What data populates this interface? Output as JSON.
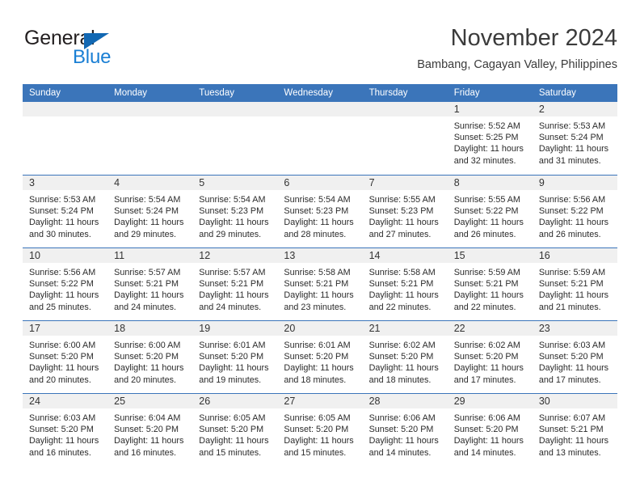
{
  "brand": {
    "name_top": "General",
    "name_bottom": "Blue",
    "triangle_color": "#1268b3",
    "blue_text_color": "#1a7fd4"
  },
  "header": {
    "month_title": "November 2024",
    "location": "Bambang, Cagayan Valley, Philippines"
  },
  "theme": {
    "header_blue": "#3b75ba",
    "daynum_band": "#f0f0f0",
    "cell_bg": "#ffffff",
    "text": "#2b2b2b"
  },
  "calendar": {
    "weekday_headers": [
      "Sunday",
      "Monday",
      "Tuesday",
      "Wednesday",
      "Thursday",
      "Friday",
      "Saturday"
    ],
    "weeks": [
      [
        {
          "day": "",
          "empty": true
        },
        {
          "day": "",
          "empty": true
        },
        {
          "day": "",
          "empty": true
        },
        {
          "day": "",
          "empty": true
        },
        {
          "day": "",
          "empty": true
        },
        {
          "day": "1",
          "sunrise": "Sunrise: 5:52 AM",
          "sunset": "Sunset: 5:25 PM",
          "daylight": "Daylight: 11 hours and 32 minutes."
        },
        {
          "day": "2",
          "sunrise": "Sunrise: 5:53 AM",
          "sunset": "Sunset: 5:24 PM",
          "daylight": "Daylight: 11 hours and 31 minutes."
        }
      ],
      [
        {
          "day": "3",
          "sunrise": "Sunrise: 5:53 AM",
          "sunset": "Sunset: 5:24 PM",
          "daylight": "Daylight: 11 hours and 30 minutes."
        },
        {
          "day": "4",
          "sunrise": "Sunrise: 5:54 AM",
          "sunset": "Sunset: 5:24 PM",
          "daylight": "Daylight: 11 hours and 29 minutes."
        },
        {
          "day": "5",
          "sunrise": "Sunrise: 5:54 AM",
          "sunset": "Sunset: 5:23 PM",
          "daylight": "Daylight: 11 hours and 29 minutes."
        },
        {
          "day": "6",
          "sunrise": "Sunrise: 5:54 AM",
          "sunset": "Sunset: 5:23 PM",
          "daylight": "Daylight: 11 hours and 28 minutes."
        },
        {
          "day": "7",
          "sunrise": "Sunrise: 5:55 AM",
          "sunset": "Sunset: 5:23 PM",
          "daylight": "Daylight: 11 hours and 27 minutes."
        },
        {
          "day": "8",
          "sunrise": "Sunrise: 5:55 AM",
          "sunset": "Sunset: 5:22 PM",
          "daylight": "Daylight: 11 hours and 26 minutes."
        },
        {
          "day": "9",
          "sunrise": "Sunrise: 5:56 AM",
          "sunset": "Sunset: 5:22 PM",
          "daylight": "Daylight: 11 hours and 26 minutes."
        }
      ],
      [
        {
          "day": "10",
          "sunrise": "Sunrise: 5:56 AM",
          "sunset": "Sunset: 5:22 PM",
          "daylight": "Daylight: 11 hours and 25 minutes."
        },
        {
          "day": "11",
          "sunrise": "Sunrise: 5:57 AM",
          "sunset": "Sunset: 5:21 PM",
          "daylight": "Daylight: 11 hours and 24 minutes."
        },
        {
          "day": "12",
          "sunrise": "Sunrise: 5:57 AM",
          "sunset": "Sunset: 5:21 PM",
          "daylight": "Daylight: 11 hours and 24 minutes."
        },
        {
          "day": "13",
          "sunrise": "Sunrise: 5:58 AM",
          "sunset": "Sunset: 5:21 PM",
          "daylight": "Daylight: 11 hours and 23 minutes."
        },
        {
          "day": "14",
          "sunrise": "Sunrise: 5:58 AM",
          "sunset": "Sunset: 5:21 PM",
          "daylight": "Daylight: 11 hours and 22 minutes."
        },
        {
          "day": "15",
          "sunrise": "Sunrise: 5:59 AM",
          "sunset": "Sunset: 5:21 PM",
          "daylight": "Daylight: 11 hours and 22 minutes."
        },
        {
          "day": "16",
          "sunrise": "Sunrise: 5:59 AM",
          "sunset": "Sunset: 5:21 PM",
          "daylight": "Daylight: 11 hours and 21 minutes."
        }
      ],
      [
        {
          "day": "17",
          "sunrise": "Sunrise: 6:00 AM",
          "sunset": "Sunset: 5:20 PM",
          "daylight": "Daylight: 11 hours and 20 minutes."
        },
        {
          "day": "18",
          "sunrise": "Sunrise: 6:00 AM",
          "sunset": "Sunset: 5:20 PM",
          "daylight": "Daylight: 11 hours and 20 minutes."
        },
        {
          "day": "19",
          "sunrise": "Sunrise: 6:01 AM",
          "sunset": "Sunset: 5:20 PM",
          "daylight": "Daylight: 11 hours and 19 minutes."
        },
        {
          "day": "20",
          "sunrise": "Sunrise: 6:01 AM",
          "sunset": "Sunset: 5:20 PM",
          "daylight": "Daylight: 11 hours and 18 minutes."
        },
        {
          "day": "21",
          "sunrise": "Sunrise: 6:02 AM",
          "sunset": "Sunset: 5:20 PM",
          "daylight": "Daylight: 11 hours and 18 minutes."
        },
        {
          "day": "22",
          "sunrise": "Sunrise: 6:02 AM",
          "sunset": "Sunset: 5:20 PM",
          "daylight": "Daylight: 11 hours and 17 minutes."
        },
        {
          "day": "23",
          "sunrise": "Sunrise: 6:03 AM",
          "sunset": "Sunset: 5:20 PM",
          "daylight": "Daylight: 11 hours and 17 minutes."
        }
      ],
      [
        {
          "day": "24",
          "sunrise": "Sunrise: 6:03 AM",
          "sunset": "Sunset: 5:20 PM",
          "daylight": "Daylight: 11 hours and 16 minutes."
        },
        {
          "day": "25",
          "sunrise": "Sunrise: 6:04 AM",
          "sunset": "Sunset: 5:20 PM",
          "daylight": "Daylight: 11 hours and 16 minutes."
        },
        {
          "day": "26",
          "sunrise": "Sunrise: 6:05 AM",
          "sunset": "Sunset: 5:20 PM",
          "daylight": "Daylight: 11 hours and 15 minutes."
        },
        {
          "day": "27",
          "sunrise": "Sunrise: 6:05 AM",
          "sunset": "Sunset: 5:20 PM",
          "daylight": "Daylight: 11 hours and 15 minutes."
        },
        {
          "day": "28",
          "sunrise": "Sunrise: 6:06 AM",
          "sunset": "Sunset: 5:20 PM",
          "daylight": "Daylight: 11 hours and 14 minutes."
        },
        {
          "day": "29",
          "sunrise": "Sunrise: 6:06 AM",
          "sunset": "Sunset: 5:20 PM",
          "daylight": "Daylight: 11 hours and 14 minutes."
        },
        {
          "day": "30",
          "sunrise": "Sunrise: 6:07 AM",
          "sunset": "Sunset: 5:21 PM",
          "daylight": "Daylight: 11 hours and 13 minutes."
        }
      ]
    ]
  }
}
